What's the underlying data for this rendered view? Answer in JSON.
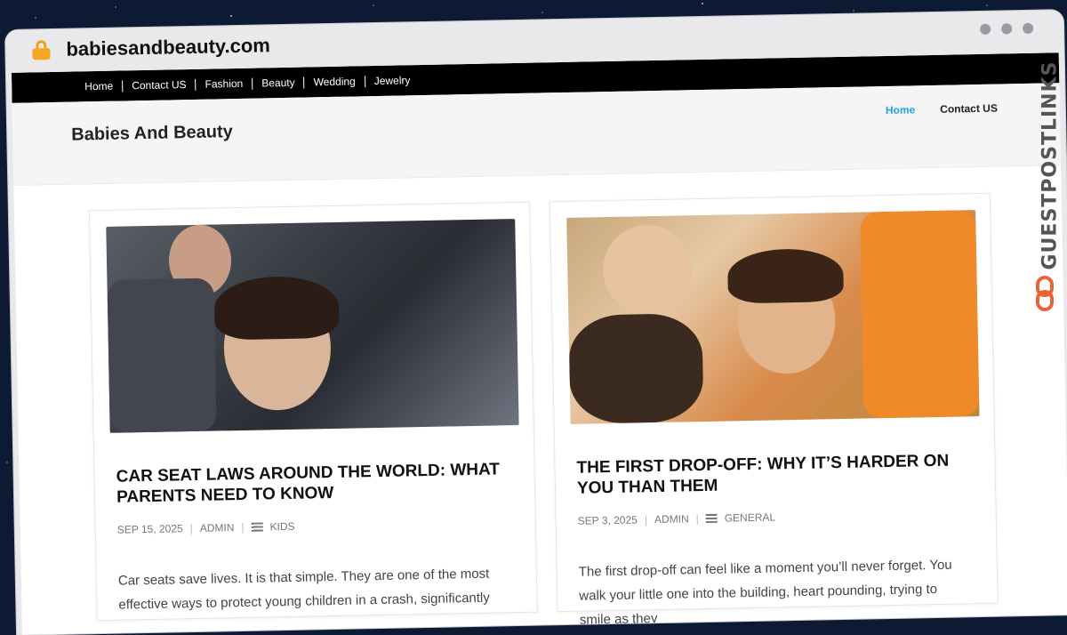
{
  "browser": {
    "url": "babiesandbeauty.com"
  },
  "topnav": {
    "items": [
      "Home",
      "Contact US",
      "Fashion",
      "Beauty",
      "Wedding",
      "Jewelry"
    ]
  },
  "header": {
    "site_title": "Babies And Beauty",
    "nav": {
      "home": "Home",
      "contact": "Contact US"
    }
  },
  "posts": [
    {
      "title": "CAR SEAT LAWS AROUND THE WORLD: WHAT PARENTS NEED TO KNOW",
      "date": "SEP 15, 2025",
      "author": "ADMIN",
      "category": "KIDS",
      "excerpt": "Car seats save lives. It is that simple. They are one of the most effective ways to protect young children in a crash, significantly"
    },
    {
      "title": "THE FIRST DROP-OFF: WHY IT’S HARDER ON YOU THAN THEM",
      "date": "SEP 3, 2025",
      "author": "ADMIN",
      "category": "GENERAL",
      "excerpt": "The first drop-off can feel like a moment you’ll never forget. You walk your little one into the building, heart pounding, trying to smile as they"
    }
  ],
  "watermark": {
    "text": "GUESTPOSTLINKS"
  },
  "colors": {
    "accent": "#2a9fd6",
    "lock": "#f5a623",
    "watermark_logo": "#e8633a"
  }
}
